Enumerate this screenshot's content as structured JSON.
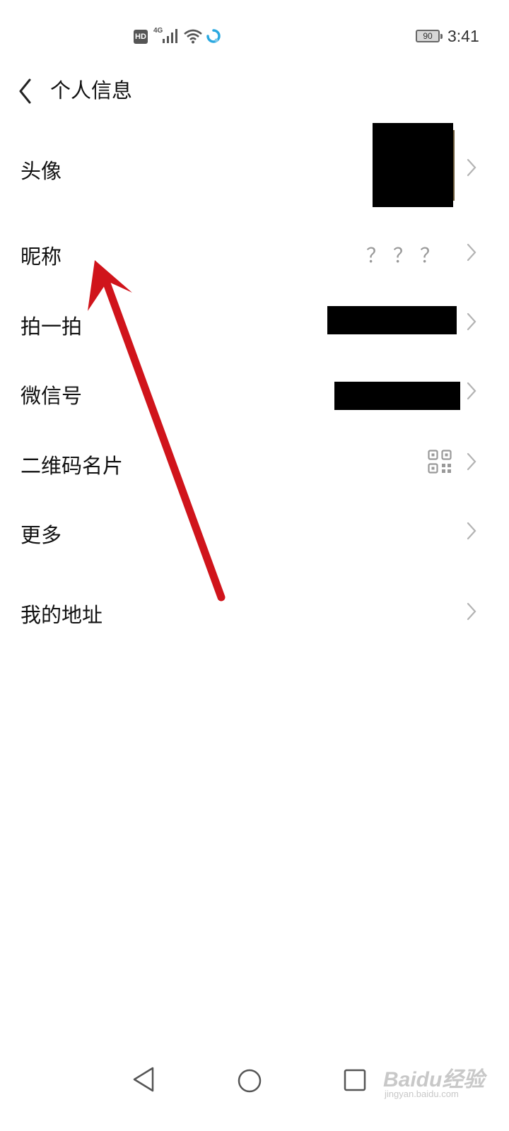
{
  "status_bar": {
    "hd_label": "HD",
    "network_label": "4G",
    "battery_level": "90",
    "time": "3:41",
    "icons": [
      "hd-icon",
      "signal-icon",
      "wifi-icon",
      "app-notification-icon",
      "battery-icon"
    ]
  },
  "header": {
    "title": "个人信息",
    "back_icon": "chevron-left-icon"
  },
  "list": {
    "items": [
      {
        "label": "头像",
        "value_type": "image"
      },
      {
        "label": "昵称",
        "value": "？？？"
      },
      {
        "label": "拍一拍",
        "value_type": "redacted"
      },
      {
        "label": "微信号",
        "value_type": "redacted"
      },
      {
        "label": "二维码名片",
        "value_type": "qr-code-icon"
      },
      {
        "label": "更多"
      },
      {
        "label": "我的地址"
      }
    ]
  },
  "nav_bar": {
    "icons": [
      "nav-back-icon",
      "nav-home-icon",
      "nav-recent-icon"
    ]
  },
  "watermark": {
    "main": "Baidu经验",
    "sub": "jingyan.baidu.com"
  },
  "colors": {
    "annotation_arrow": "#d0141b",
    "chevron": "#b3b3b3",
    "value_text": "#999999"
  }
}
